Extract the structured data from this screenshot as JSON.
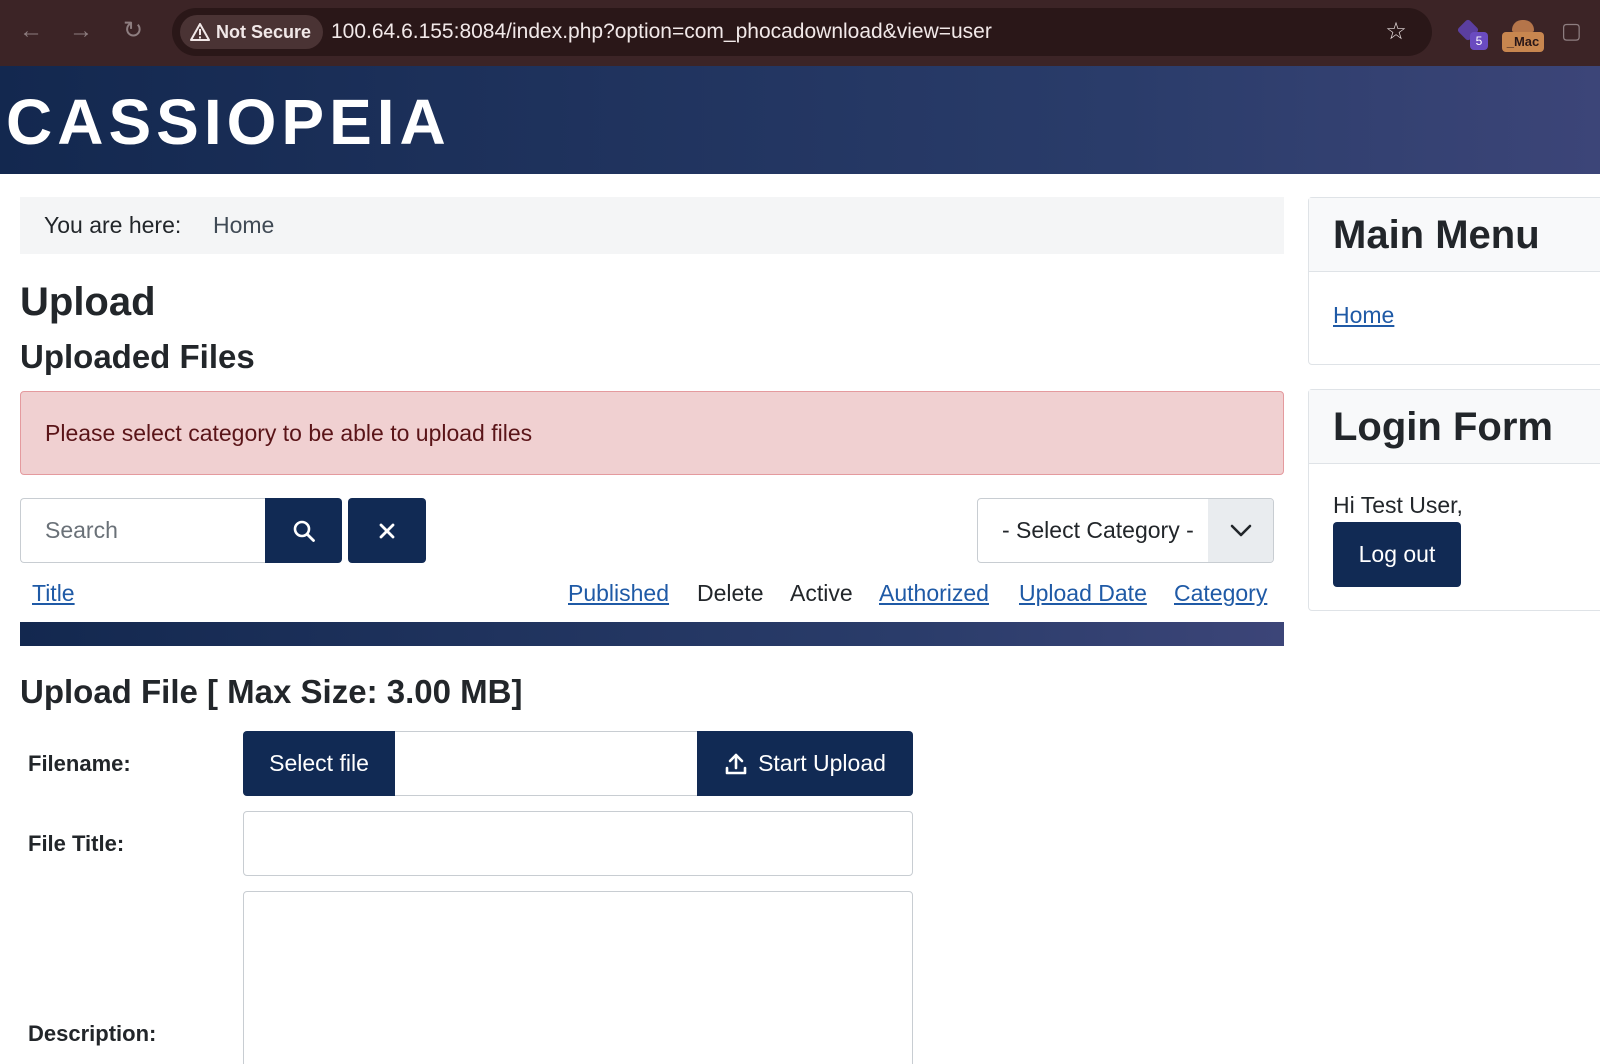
{
  "browser": {
    "security_label": "Not Secure",
    "url": "100.64.6.155:8084/index.php?option=com_phocadownload&view=user",
    "extension_badge": "5",
    "extension_label": "_Mac"
  },
  "site": {
    "brand": "CASSIOPEIA"
  },
  "breadcrumb": {
    "label": "You are here:",
    "items": [
      "Home"
    ]
  },
  "page": {
    "title": "Upload",
    "subtitle": "Uploaded Files",
    "alert": "Please select category to be able to upload files"
  },
  "filter": {
    "search_placeholder": "Search",
    "category_select": "- Select Category -"
  },
  "table": {
    "columns": [
      {
        "label": "Title",
        "sortable": true
      },
      {
        "label": "Published",
        "sortable": true
      },
      {
        "label": "Delete",
        "sortable": false
      },
      {
        "label": "Active",
        "sortable": false
      },
      {
        "label": "Authorized",
        "sortable": true
      },
      {
        "label": "Upload Date",
        "sortable": true
      },
      {
        "label": "Category",
        "sortable": true
      }
    ]
  },
  "upload_form": {
    "heading": "Upload File [ Max Size: 3.00 MB]",
    "filename_label": "Filename:",
    "select_file_button": "Select file",
    "start_upload_button": "Start Upload",
    "file_title_label": "File Title:",
    "description_label": "Description:"
  },
  "sidebar": {
    "main_menu": {
      "title": "Main Menu",
      "items": [
        "Home"
      ]
    },
    "login_form": {
      "title": "Login Form",
      "greeting": "Hi Test User,",
      "logout_button": "Log out"
    }
  },
  "colors": {
    "primary": "#112a54",
    "link": "#1f5aa6",
    "alert_bg": "#f0d0d1",
    "browser_frame": "#3c2426"
  },
  "icons": [
    "back-arrow-icon",
    "forward-arrow-icon",
    "reload-icon",
    "warning-triangle-icon",
    "star-icon",
    "puzzle-extension-icon",
    "search-icon",
    "close-icon",
    "chevron-down-icon",
    "upload-icon",
    "extensions-menu-icon"
  ]
}
